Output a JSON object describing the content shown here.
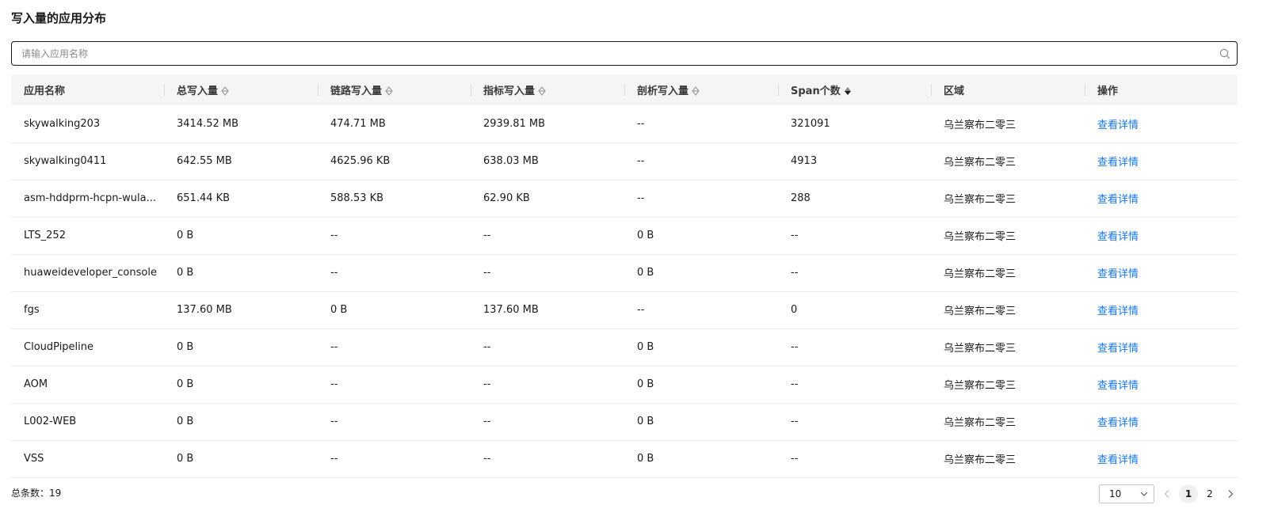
{
  "page": {
    "title": "写入量的应用分布"
  },
  "search": {
    "placeholder": "请输入应用名称"
  },
  "table": {
    "headers": {
      "app_name": "应用名称",
      "total": "总写入量",
      "trace": "链路写入量",
      "metric": "指标写入量",
      "profile": "剖析写入量",
      "span": "Span个数",
      "region": "区域",
      "action": "操作"
    },
    "rows": [
      {
        "app_name": "skywalking203",
        "total": "3414.52 MB",
        "trace": "474.71 MB",
        "metric": "2939.81 MB",
        "profile": "--",
        "span": "321091",
        "region": "乌兰察布二零三",
        "action": "查看详情"
      },
      {
        "app_name": "skywalking0411",
        "total": "642.55 MB",
        "trace": "4625.96 KB",
        "metric": "638.03 MB",
        "profile": "--",
        "span": "4913",
        "region": "乌兰察布二零三",
        "action": "查看详情"
      },
      {
        "app_name": "asm-hddprm-hcpn-wula...",
        "total": "651.44 KB",
        "trace": "588.53 KB",
        "metric": "62.90 KB",
        "profile": "--",
        "span": "288",
        "region": "乌兰察布二零三",
        "action": "查看详情"
      },
      {
        "app_name": "LTS_252",
        "total": "0 B",
        "trace": "--",
        "metric": "--",
        "profile": "0 B",
        "span": "--",
        "region": "乌兰察布二零三",
        "action": "查看详情"
      },
      {
        "app_name": "huaweideveloper_console",
        "total": "0 B",
        "trace": "--",
        "metric": "--",
        "profile": "0 B",
        "span": "--",
        "region": "乌兰察布二零三",
        "action": "查看详情"
      },
      {
        "app_name": "fgs",
        "total": "137.60 MB",
        "trace": "0 B",
        "metric": "137.60 MB",
        "profile": "--",
        "span": "0",
        "region": "乌兰察布二零三",
        "action": "查看详情"
      },
      {
        "app_name": "CloudPipeline",
        "total": "0 B",
        "trace": "--",
        "metric": "--",
        "profile": "0 B",
        "span": "--",
        "region": "乌兰察布二零三",
        "action": "查看详情"
      },
      {
        "app_name": "AOM",
        "total": "0 B",
        "trace": "--",
        "metric": "--",
        "profile": "0 B",
        "span": "--",
        "region": "乌兰察布二零三",
        "action": "查看详情"
      },
      {
        "app_name": "L002-WEB",
        "total": "0 B",
        "trace": "--",
        "metric": "--",
        "profile": "0 B",
        "span": "--",
        "region": "乌兰察布二零三",
        "action": "查看详情"
      },
      {
        "app_name": "VSS",
        "total": "0 B",
        "trace": "--",
        "metric": "--",
        "profile": "0 B",
        "span": "--",
        "region": "乌兰察布二零三",
        "action": "查看详情"
      }
    ]
  },
  "pagination": {
    "total_label": "总条数：19",
    "page_size": "10",
    "pages": [
      "1",
      "2"
    ],
    "current_page": "1"
  },
  "colors": {
    "link": "#1476ff",
    "header_bg": "#f5f5f5",
    "active_sort": "#191919",
    "inactive_sort": "#8a8a8a"
  },
  "icons": {
    "search": "search-icon",
    "sort": "sort-icon",
    "sort_active": "sort-desc-icon",
    "dropdown": "chevron-down-icon",
    "prev": "chevron-left-icon",
    "next": "chevron-right-icon"
  }
}
